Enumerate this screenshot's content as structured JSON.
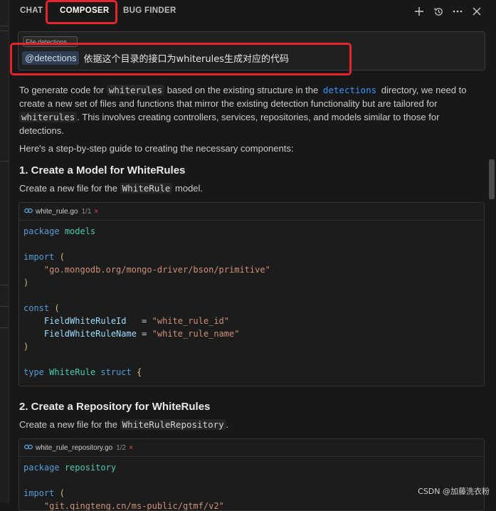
{
  "tabs": [
    {
      "label": "CHAT"
    },
    {
      "label": "COMPOSER"
    },
    {
      "label": "BUG FINDER"
    }
  ],
  "toolbar_icons": [
    "plus-icon",
    "history-icon",
    "more-icon",
    "close-icon"
  ],
  "input": {
    "context_chip": "File detections",
    "mention": "@detections",
    "query": "依据这个目录的接口为whiterules生成对应的代码"
  },
  "response": {
    "intro": {
      "p1": "To generate code for",
      "code1": "whiterules",
      "p2": "based on the existing structure in the",
      "link": "detections",
      "p3": "directory, we need to create a new set of files and functions that mirror the existing detection functionality but are tailored for",
      "code2": "whiterules",
      "p4": ". This involves creating controllers, services, repositories, and models similar to those for detections."
    },
    "guide": "Here's a step-by-step guide to creating the necessary components:",
    "section1": {
      "heading": "1. Create a Model for WhiteRules",
      "text_before": "Create a new file for the",
      "code": "WhiteRule",
      "text_after": "model.",
      "file": {
        "name": "white_rule.go",
        "count": "1/1",
        "close": "×"
      },
      "lines": [
        "package models",
        "",
        "import (",
        "    \"go.mongodb.org/mongo-driver/bson/primitive\"",
        ")",
        "",
        "const (",
        "    FieldWhiteRuleId   = \"white_rule_id\"",
        "    FieldWhiteRuleName = \"white_rule_name\"",
        ")",
        "",
        "type WhiteRule struct {"
      ]
    },
    "section2": {
      "heading": "2. Create a Repository for WhiteRules",
      "text_before": "Create a new file for the",
      "code": "WhiteRuleRepository",
      "text_after": ".",
      "file": {
        "name": "white_rule_repository.go",
        "count": "1/2",
        "close": "×"
      },
      "lines": [
        "package repository",
        "",
        "import (",
        "    \"git.qingteng.cn/ms-public/gtmf/v2\""
      ]
    }
  },
  "watermark": "CSDN @加藤洗衣粉",
  "colors": {
    "highlight_border": "#e5252d",
    "link": "#3794ff",
    "keyword": "#569cd6",
    "string": "#ce9178"
  }
}
